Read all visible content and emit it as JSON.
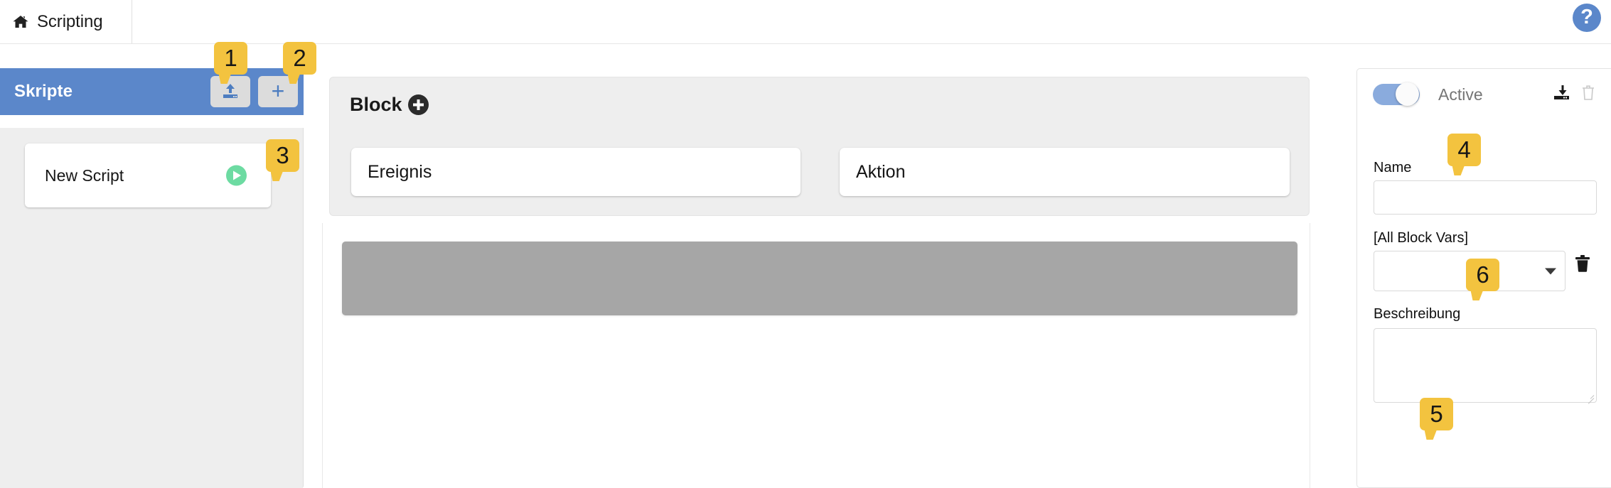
{
  "header": {
    "home_icon": "home-icon",
    "breadcrumb_label": "Scripting",
    "help_icon": "question-mark-icon",
    "help_label": "?"
  },
  "sidebar": {
    "title": "Skripte",
    "upload_icon": "upload-icon",
    "add_icon": "plus-icon",
    "add_label": "+",
    "scripts": [
      {
        "name": "New Script",
        "run_icon": "play-icon"
      }
    ]
  },
  "block_panel": {
    "title": "Block",
    "add_icon": "plus-circle-icon",
    "event_slot_label": "Ereignis",
    "action_slot_label": "Aktion"
  },
  "canvas": {
    "placeholder_block": "block-placeholder"
  },
  "properties": {
    "toggle": {
      "state": "on",
      "label": "Active"
    },
    "download_icon": "download-icon",
    "delete_icon": "trash-icon",
    "name_label": "Name",
    "name_value": "",
    "name_placeholder": "",
    "block_vars_label": "[All Block Vars]",
    "block_vars_value": "",
    "block_vars_caret_icon": "chevron-down-icon",
    "block_vars_delete_icon": "trash-icon",
    "description_label": "Beschreibung",
    "description_value": "",
    "description_placeholder": ""
  },
  "callouts": [
    {
      "id": "1",
      "target": "sidebar-upload-button"
    },
    {
      "id": "2",
      "target": "sidebar-add-button"
    },
    {
      "id": "3",
      "target": "script-run-button"
    },
    {
      "id": "4",
      "target": "name-input"
    },
    {
      "id": "5",
      "target": "description-textarea"
    },
    {
      "id": "6",
      "target": "block-vars-select"
    }
  ],
  "colors": {
    "accent_blue": "#5b87ca",
    "toggle_blue": "#8aabdd",
    "callout_yellow": "#f3c33f",
    "play_green": "#6ddba2",
    "panel_gray": "#eeeeee",
    "block_gray": "#a6a6a6"
  }
}
